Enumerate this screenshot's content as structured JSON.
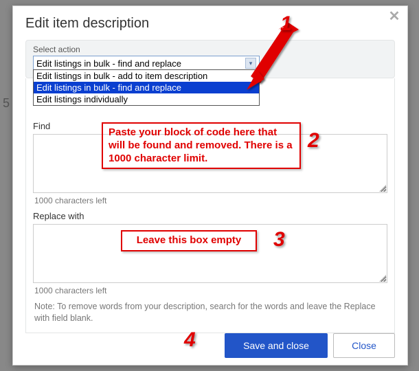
{
  "modal": {
    "title": "Edit item description",
    "close_symbol": "✕"
  },
  "action": {
    "label": "Select action",
    "value": "Edit listings in bulk - find and replace",
    "caret": "▾",
    "options": [
      "Edit listings in bulk - add to item description",
      "Edit listings in bulk - find and replace",
      "Edit listings individually"
    ],
    "selected_index": 1
  },
  "find": {
    "label": "Find",
    "value": "",
    "chars_left": "1000 characters left"
  },
  "replace": {
    "label": "Replace with",
    "value": "",
    "chars_left": "1000 characters left"
  },
  "note": "Note: To remove words from your description, search for the words and leave the Replace with field blank.",
  "buttons": {
    "save": "Save and close",
    "close": "Close"
  },
  "annotations": {
    "n1": "1",
    "n2": "2",
    "n3": "3",
    "n4": "4",
    "box1": "Paste your block of code here that will be found and removed. There is a 1000 character limit.",
    "box2": "Leave this box empty"
  },
  "background": {
    "partial_count": "5"
  }
}
